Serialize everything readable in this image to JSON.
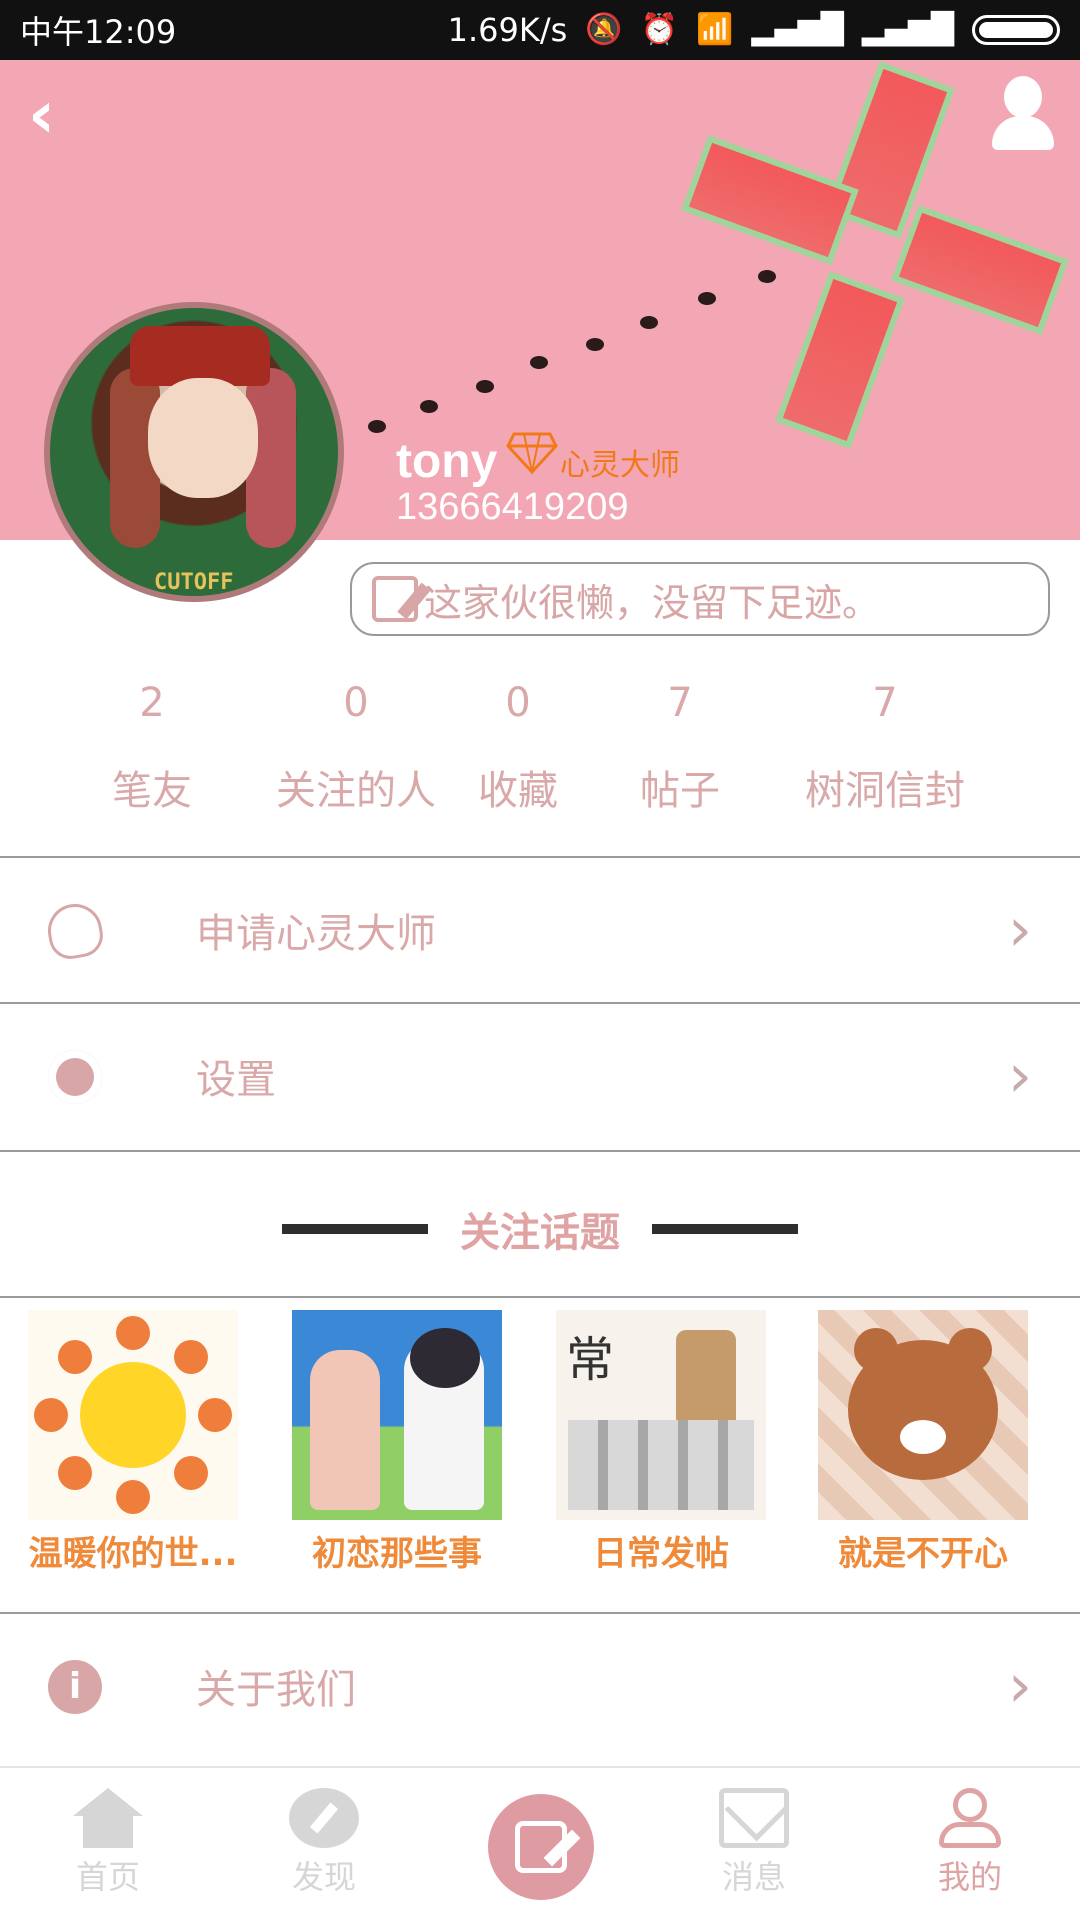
{
  "status_bar": {
    "time": "中午12:09",
    "speed": "1.69K/s"
  },
  "header": {
    "username": "tony",
    "vip_label": "心灵大师",
    "phone": "13666419209",
    "signature": "这家伙很懒，没留下足迹。"
  },
  "stats": [
    {
      "value": "2",
      "label": "笔友"
    },
    {
      "value": "0",
      "label": "关注的人"
    },
    {
      "value": "0",
      "label": "收藏"
    },
    {
      "value": "7",
      "label": "帖子"
    },
    {
      "value": "7",
      "label": "树洞信封"
    }
  ],
  "menu": {
    "apply_master": "申请心灵大师",
    "settings": "设置",
    "about": "关于我们"
  },
  "topics": {
    "title": "关注话题",
    "items": [
      {
        "label": "温暖你的世..."
      },
      {
        "label": "初恋那些事"
      },
      {
        "label": "日常发帖"
      },
      {
        "label": "就是不开心"
      }
    ],
    "daily_glyph": "常"
  },
  "bottom_nav": {
    "home": "首页",
    "discover": "发现",
    "messages": "消息",
    "mine": "我的"
  },
  "colors": {
    "header_bg": "#f3a7b4",
    "accent_pink": "#d9a9a9",
    "topic_orange": "#ef8a3a",
    "post_button": "#de9ca2"
  }
}
